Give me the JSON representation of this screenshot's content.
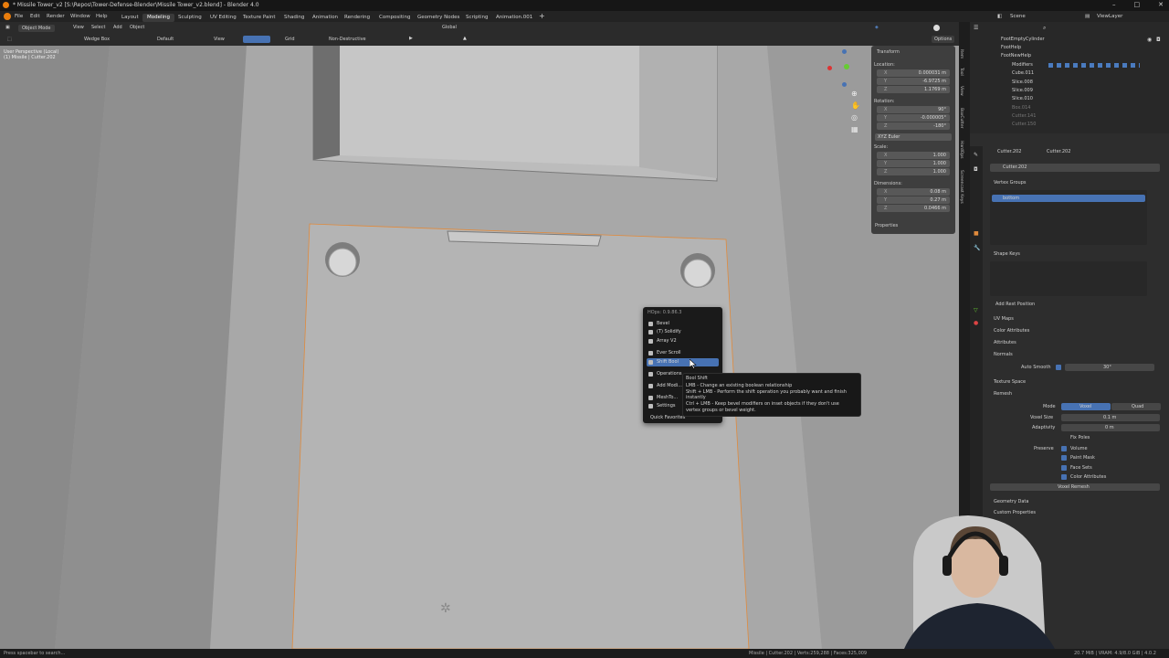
{
  "window": {
    "title": "* Missile Tower_v2 [S:\\Repos\\Tower-Defense-Blender\\Missile Tower_v2.blend] - Blender 4.0"
  },
  "menu": [
    "File",
    "Edit",
    "Render",
    "Window",
    "Help"
  ],
  "workspaces": [
    "Layout",
    "Modeling",
    "Sculpting",
    "UV Editing",
    "Texture Paint",
    "Shading",
    "Animation",
    "Rendering",
    "Compositing",
    "Geometry Nodes",
    "Scripting",
    "Animation.001"
  ],
  "scene": {
    "scene_label": "Scene",
    "view_layer": "ViewLayer"
  },
  "header": {
    "object_mode": "Object Mode",
    "menus": [
      "View",
      "Select",
      "Add",
      "Object"
    ],
    "tool": "Wedge Box",
    "pivot": "Default",
    "view": "View",
    "grid": "Grid",
    "non_destructive": "Non-Destructive",
    "orientation": "Global",
    "options": "Options"
  },
  "viewport": {
    "overlay_line1": "User Perspective (Local)",
    "overlay_line2": "(1) Missile | Cutter.202"
  },
  "npanel": {
    "title": "Transform",
    "location_label": "Location:",
    "location": {
      "x": "0.000031 m",
      "y": "-6.9725 m",
      "z": "1.1769 m"
    },
    "rotation_label": "Rotation:",
    "rotation": {
      "x": "90°",
      "y": "-0.000005°",
      "z": "-180°"
    },
    "rotation_mode": "XYZ Euler",
    "scale_label": "Scale:",
    "scale": {
      "x": "1.000",
      "y": "1.000",
      "z": "1.000"
    },
    "dimensions_label": "Dimensions:",
    "dimensions": {
      "x": "0.08 m",
      "y": "0.27 m",
      "z": "0.0466 m"
    },
    "properties": "Properties"
  },
  "side_tabs": [
    "Item",
    "Tool",
    "View",
    "BoxCutter",
    "HardOps",
    "Screencast Keys"
  ],
  "outliner": {
    "items": [
      "FootEmptyCylinder",
      "FootHelp",
      "FootNewHelp",
      "Modifiers",
      "Cube.011",
      "Slice.008",
      "Slice.009",
      "Slice.010",
      "Box.014",
      "Cutter.141",
      "Cutter.150"
    ]
  },
  "properties": {
    "breadcrumb1": "Cutter.202",
    "breadcrumb2": "Cutter.202",
    "object_name": "Cutter.202",
    "vertex_groups": "Vertex Groups",
    "vg_item": "bottom",
    "shape_keys": "Shape Keys",
    "add_rest_position": "Add Rest Position",
    "uv_maps": "UV Maps",
    "color_attributes": "Color Attributes",
    "attributes": "Attributes",
    "normals": "Normals",
    "auto_smooth": "Auto Smooth",
    "auto_smooth_angle": "30°",
    "texture_space": "Texture Space",
    "remesh": "Remesh",
    "mode_label": "Mode",
    "mode_voxel": "Voxel",
    "mode_quad": "Quad",
    "voxel_size_label": "Voxel Size",
    "voxel_size": "0.1 m",
    "adaptivity_label": "Adaptivity",
    "adaptivity": "0 m",
    "fix_poles": "Fix Poles",
    "preserve_label": "Preserve",
    "preserve_volume": "Volume",
    "preserve_paint_mask": "Paint Mask",
    "preserve_face_sets": "Face Sets",
    "preserve_color_attributes": "Color Attributes",
    "voxel_remesh": "Voxel Remesh",
    "geometry_data": "Geometry Data",
    "custom_properties": "Custom Properties"
  },
  "context_menu": {
    "header": "HOps: 0.9.86.3",
    "items": [
      "Bevel",
      "(T) Solidify",
      "Array V2",
      "Ever Scroll",
      "Shift Bool",
      "Operations",
      "Add Modi...",
      "MeshTo...",
      "Settings",
      "Quick Favorites"
    ],
    "highlighted_index": 4
  },
  "tooltip": {
    "title": "Bool Shift",
    "line1": "LMB - Change an existing boolean relationship",
    "line2": "Shift + LMB - Perform the shift operation you probably want and finish",
    "line3": "instantly",
    "line4": "Ctrl + LMB - Keep bevel modifiers on inset objects if they don't use",
    "line5": "vertex groups or bevel weight."
  },
  "statusbar": {
    "left": "Press spacebar to search...",
    "center": "Missile | Cutter.202 | Verts:259,288 | Faces:325,009",
    "right": "20.7 MiB | VRAM: 4.9/8.0 GiB | 4.0.2"
  },
  "colors": {
    "accent": "#4772b3",
    "highlight_orange": "#e08a3c",
    "viewport_bg": "#9c9c9c"
  }
}
